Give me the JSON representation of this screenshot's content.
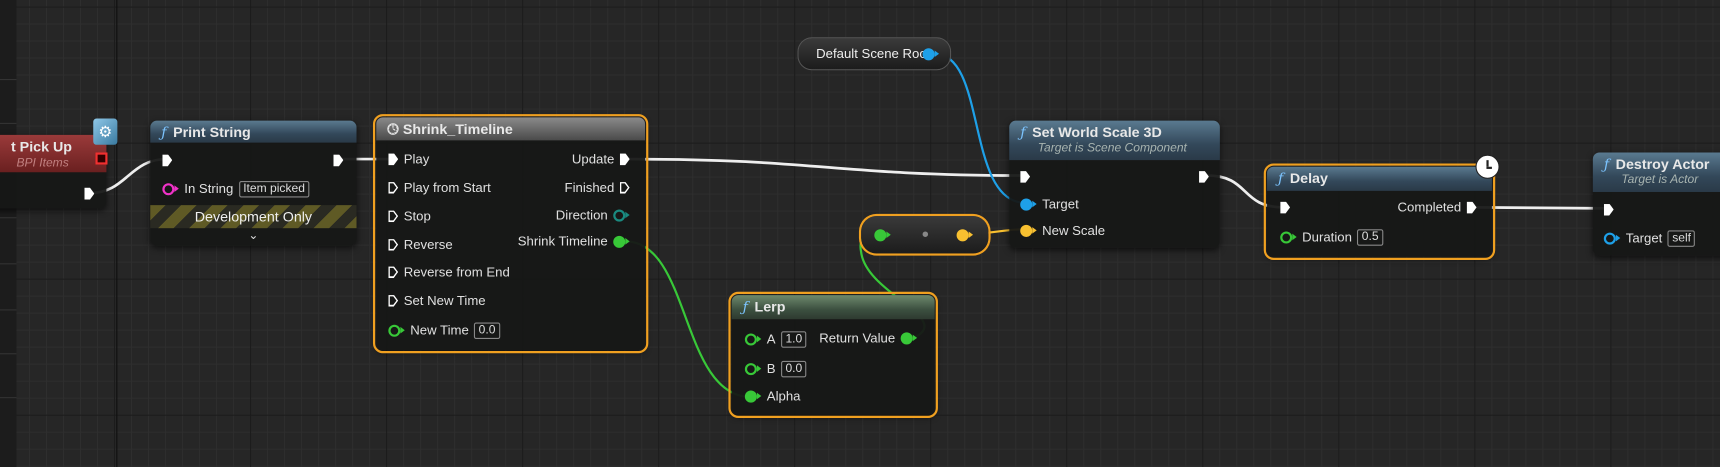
{
  "event_node": {
    "title": "t Pick Up",
    "subtitle": "BPI Items"
  },
  "print_string": {
    "title": "Print String",
    "in_string_label": "In String",
    "in_string_value": "Item picked",
    "development_only": "Development Only",
    "expand": "⌄"
  },
  "timeline": {
    "title": "Shrink_Timeline",
    "inputs": [
      "Play",
      "Play from Start",
      "Stop",
      "Reverse",
      "Reverse from End",
      "Set New Time",
      "New Time"
    ],
    "new_time_value": "0.0",
    "outputs": [
      "Update",
      "Finished",
      "Direction",
      "Shrink Timeline"
    ]
  },
  "scene_root": {
    "label": "Default Scene Root"
  },
  "set_world_scale": {
    "title": "Set World Scale 3D",
    "subtitle": "Target is Scene Component",
    "target": "Target",
    "new_scale": "New Scale"
  },
  "lerp": {
    "title": "Lerp",
    "a_label": "A",
    "a_value": "1.0",
    "b_label": "B",
    "b_value": "0.0",
    "alpha": "Alpha",
    "return_value": "Return Value"
  },
  "delay": {
    "title": "Delay",
    "completed": "Completed",
    "duration_label": "Duration",
    "duration_value": "0.5"
  },
  "destroy_actor": {
    "title": "Destroy Actor",
    "subtitle": "Target is Actor",
    "target": "Target",
    "target_value": "self"
  },
  "colors": {
    "exec": "#ffffff",
    "string": "#f032c8",
    "float": "#38c838",
    "vector": "#f8c030",
    "object": "#1ea0e8",
    "selection": "#f0a020"
  }
}
